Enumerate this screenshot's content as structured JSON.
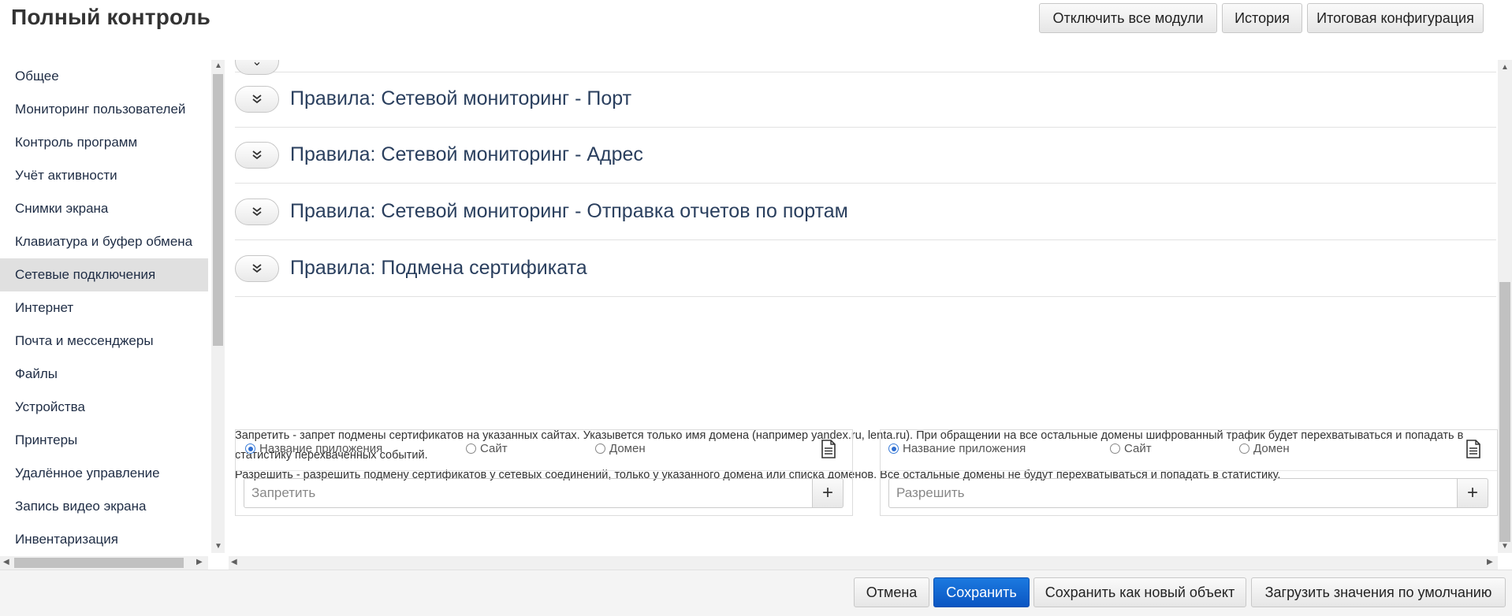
{
  "header": {
    "title": "Полный контроль",
    "buttons": [
      "Отключить все модули",
      "История",
      "Итоговая конфигурация"
    ]
  },
  "sidebar": {
    "items": [
      {
        "label": "Общее",
        "active": false
      },
      {
        "label": "Мониторинг пользователей",
        "active": false
      },
      {
        "label": "Контроль программ",
        "active": false
      },
      {
        "label": "Учёт активности",
        "active": false
      },
      {
        "label": "Снимки экрана",
        "active": false
      },
      {
        "label": "Клавиатура и буфер обмена",
        "active": false
      },
      {
        "label": "Сетевые подключения",
        "active": true
      },
      {
        "label": "Интернет",
        "active": false
      },
      {
        "label": "Почта и мессенджеры",
        "active": false
      },
      {
        "label": "Файлы",
        "active": false
      },
      {
        "label": "Устройства",
        "active": false
      },
      {
        "label": "Принтеры",
        "active": false
      },
      {
        "label": "Удалённое управление",
        "active": false
      },
      {
        "label": "Запись видео экрана",
        "active": false
      },
      {
        "label": "Инвентаризация",
        "active": false
      }
    ]
  },
  "main": {
    "sections": [
      {
        "title": "Правила: Сетевой мониторинг - Порт"
      },
      {
        "title": "Правила: Сетевой мониторинг - Адрес"
      },
      {
        "title": "Правила: Сетевой мониторинг - Отправка отчетов по портам"
      },
      {
        "title": "Правила: Подмена сертификата"
      }
    ],
    "description": {
      "line1": "Запретить - запрет подмены сертификатов на указанных сайтах. Указывется только имя домена (например yandex.ru, lenta.ru). При обращении на все остальные домены шифрованный трафик будет перехватываться и попадать в",
      "line2": "статистику перехваченных событий.",
      "line3": "Разрешить - разрешить подмену сертификатов у сетевых соединений, только у указанного домена или списка доменов. Все остальные домены не будут перехватываться и попадать в статистику."
    },
    "deny_panel": {
      "radios": [
        "Название приложения",
        "Сайт",
        "Домен"
      ],
      "selected": "Название приложения",
      "placeholder": "Запретить",
      "add_label": "+"
    },
    "allow_panel": {
      "radios": [
        "Название приложения",
        "Сайт",
        "Домен"
      ],
      "selected": "Название приложения",
      "placeholder": "Разрешить",
      "add_label": "+"
    }
  },
  "footer": {
    "cancel": "Отмена",
    "save": "Сохранить",
    "save_as_new": "Сохранить как новый объект",
    "load_defaults": "Загрузить значения по умолчанию"
  },
  "colors": {
    "primary": "#0a66d6",
    "heading": "#2a3f5e",
    "active_item": "#e0e0e0"
  }
}
